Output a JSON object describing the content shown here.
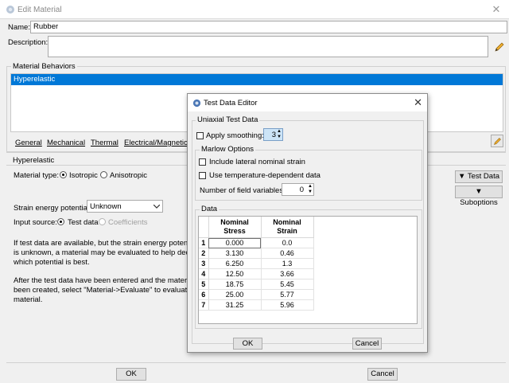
{
  "window": {
    "title": "Edit Material",
    "close_glyph": "✕"
  },
  "fields": {
    "name_label": "Name:",
    "name_value": "Rubber",
    "description_label": "Description:",
    "description_value": ""
  },
  "behaviors": {
    "title": "Material Behaviors",
    "items": [
      "Hyperelastic"
    ],
    "selected_color": "#0078d7"
  },
  "menu_tabs": [
    {
      "label": "General"
    },
    {
      "label": "Mechanical"
    },
    {
      "label": "Thermal"
    },
    {
      "label": "Electrical/Magnetic"
    }
  ],
  "hyper": {
    "section_title": "Hyperelastic",
    "material_type_label": "Material type:",
    "isotropic": "Isotropic",
    "anisotropic": "Anisotropic",
    "strain_energy_label": "Strain energy potential:",
    "strain_energy_value": "Unknown",
    "input_source_label": "Input source:",
    "test_data": "Test data",
    "coefficients": "Coefficients",
    "help1_lines": [
      "If test data are available, but the strain energy potential",
      "is unknown, a material may be evaluated to help decide",
      "which potential is best."
    ],
    "help2_lines": [
      "After the test data have been entered and the material h",
      "been created, select \"Material->Evaluate\" to evaluate a",
      "material."
    ],
    "test_data_btn": "Test Data",
    "suboptions_btn": "Suboptions"
  },
  "main_buttons": {
    "ok": "OK",
    "cancel": "Cancel"
  },
  "dialog": {
    "title": "Test Data Editor",
    "group_title": "Uniaxial Test Data",
    "apply_smoothing": "Apply smoothing:",
    "smoothing_value": "3",
    "marlow_title": "Marlow Options",
    "include_lateral": "Include lateral nominal strain",
    "use_temp": "Use temperature-dependent data",
    "field_vars_label": "Number of field variables:",
    "field_vars_value": "0",
    "data_title": "Data",
    "columns": [
      "Nominal\nStress",
      "Nominal\nStrain"
    ],
    "rows": [
      {
        "n": "1",
        "stress": "0.000",
        "strain": "0.0"
      },
      {
        "n": "2",
        "stress": "3.130",
        "strain": "0.46"
      },
      {
        "n": "3",
        "stress": "6.250",
        "strain": "1.3"
      },
      {
        "n": "4",
        "stress": "12.50",
        "strain": "3.66"
      },
      {
        "n": "5",
        "stress": "18.75",
        "strain": "5.45"
      },
      {
        "n": "6",
        "stress": "25.00",
        "strain": "5.77"
      },
      {
        "n": "7",
        "stress": "31.25",
        "strain": "5.96"
      }
    ],
    "ok": "OK",
    "cancel": "Cancel"
  }
}
